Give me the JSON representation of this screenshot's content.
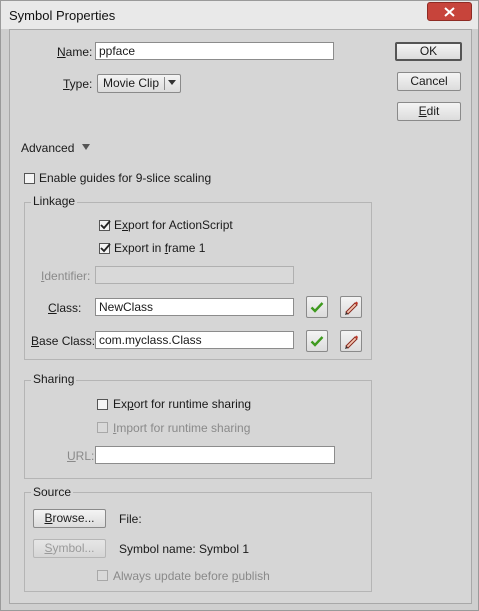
{
  "window": {
    "title": "Symbol Properties",
    "close_icon": "close-icon"
  },
  "form": {
    "name_label": "ame:",
    "name_label_prefix": "N",
    "name_value": "ppface",
    "type_label_prefix": "T",
    "type_label": "ype:",
    "type_value": "Movie Clip"
  },
  "buttons": {
    "ok": "OK",
    "cancel": "Cancel",
    "edit_prefix": "E",
    "edit": "dit"
  },
  "advanced": {
    "label": "Advanced",
    "guides_pre": "Enable ",
    "guides_u": "g",
    "guides_post": "uides for 9-slice scaling",
    "guides_checked": false
  },
  "linkage": {
    "title": "Linkage",
    "export_as_pre": "E",
    "export_as_u": "x",
    "export_as_post": "port for ActionScript",
    "export_as_checked": true,
    "export_frame_pre": "Export in ",
    "export_frame_u": "f",
    "export_frame_post": "rame 1",
    "export_frame_checked": true,
    "identifier_u": "I",
    "identifier_label": "dentifier:",
    "identifier_value": "",
    "class_u": "C",
    "class_label": "lass:",
    "class_value": "NewClass",
    "base_class_u": "B",
    "base_class_label": "ase Class:",
    "base_class_value": "com.myclass.Class"
  },
  "sharing": {
    "title": "Sharing",
    "export_runtime_pre": "Ex",
    "export_runtime_u": "p",
    "export_runtime_post": "ort for runtime sharing",
    "export_runtime_checked": false,
    "import_runtime_u": "I",
    "import_runtime_post": "mport for runtime sharing",
    "import_runtime_checked": false,
    "url_u": "U",
    "url_label": "RL:",
    "url_value": ""
  },
  "source": {
    "title": "Source",
    "browse_u": "B",
    "browse_label": "rowse...",
    "file_label": "File:",
    "symbol_u": "S",
    "symbol_label": "ymbol...",
    "symbol_name": "Symbol name: Symbol 1",
    "always_update_pre": "Always update before ",
    "always_update_u": "p",
    "always_update_post": "ublish",
    "always_update_checked": false
  },
  "colors": {
    "close_red": "#c7443b",
    "check_green": "#3f9a1f",
    "pencil_red": "#c0392b"
  }
}
